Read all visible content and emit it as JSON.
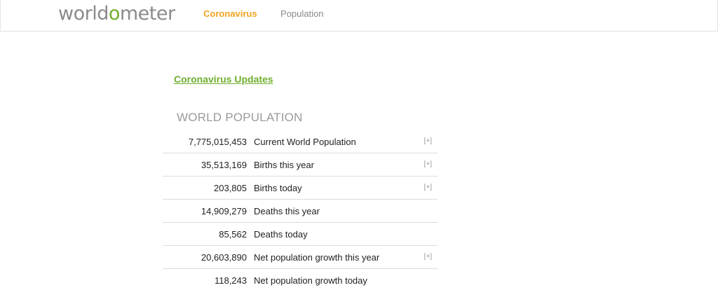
{
  "header": {
    "logo": {
      "before": "world",
      "o": "o",
      "after": "meter"
    },
    "nav": [
      {
        "label": "Coronavirus",
        "color": "#f0a41e"
      },
      {
        "label": "Population",
        "color": "#8a8a8a"
      }
    ]
  },
  "main": {
    "updates_link": "Coronavirus Updates",
    "section_title": "WORLD POPULATION",
    "rows": [
      {
        "value": "7,775,015,453",
        "label": "Current World Population",
        "expand": "[+]"
      },
      {
        "value": "35,513,169",
        "label": "Births this year",
        "expand": "[+]"
      },
      {
        "value": "203,805",
        "label": "Births today",
        "expand": "[+]"
      },
      {
        "value": "14,909,279",
        "label": "Deaths this year",
        "expand": ""
      },
      {
        "value": "85,562",
        "label": "Deaths today",
        "expand": ""
      },
      {
        "value": "20,603,890",
        "label": "Net population growth this year",
        "expand": "[+]"
      },
      {
        "value": "118,243",
        "label": "Net population growth today",
        "expand": ""
      }
    ]
  },
  "colors": {
    "brand_green": "#6fae2e",
    "accent_orange": "#f0a41e",
    "muted_gray": "#8a8a8a"
  }
}
